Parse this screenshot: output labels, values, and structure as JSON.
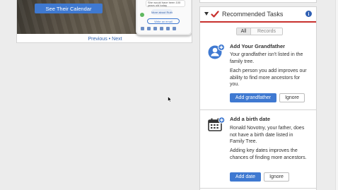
{
  "promo": {
    "button_label": "See Their Calendar",
    "phone_message": "She would have been 100 years old today",
    "phone_pill": "More about Ruth",
    "phone_chip": "Write an email",
    "pager": {
      "previous": "Previous",
      "separator": "•",
      "next": "Next"
    }
  },
  "tasks_panel": {
    "title": "Recommended Tasks",
    "tabs": {
      "all": "All",
      "records": "Records"
    },
    "accent_color": "#c8312e",
    "items": [
      {
        "icon": "add-person-icon",
        "title": "Add Your Grandfather",
        "text1": "Your grandfather isn't listed in the family tree.",
        "text2": "Each person you add improves our ability to find more ancestors for you.",
        "primary_label": "Add grandfather",
        "secondary_label": "Ignore"
      },
      {
        "icon": "add-date-icon",
        "title": "Add a birth date",
        "text1": "Ronald Novotny, your father, does not have a birth date listed in Family Tree.",
        "text2": "Adding key dates improves the chances of finding more ancestors.",
        "primary_label": "Add date",
        "secondary_label": "Ignore"
      }
    ]
  },
  "colors": {
    "primary_button": "#3f79d1",
    "info_icon": "#2f5fb3"
  }
}
